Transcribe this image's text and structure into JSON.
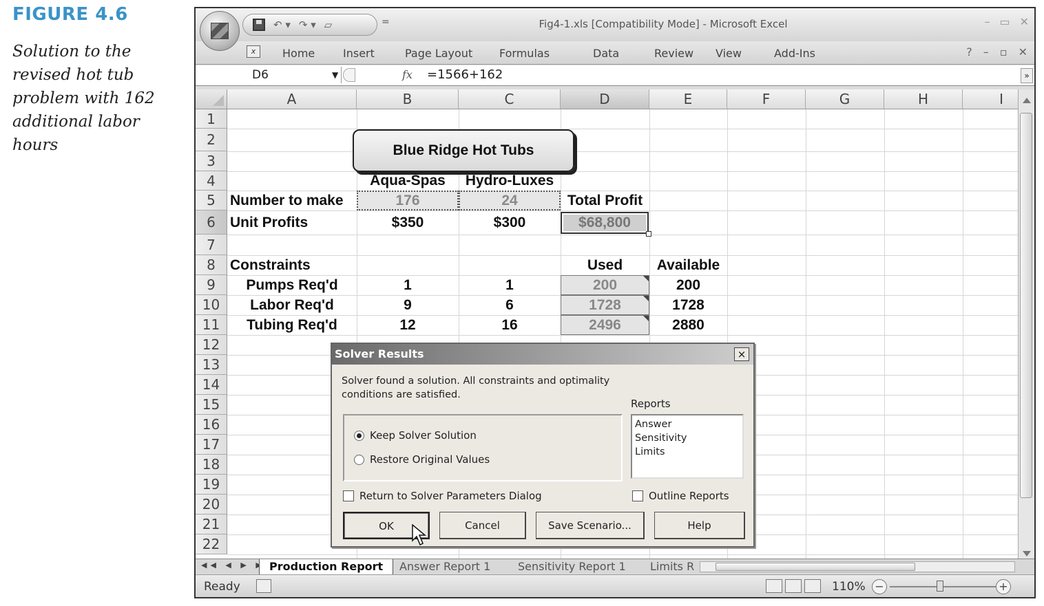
{
  "figure": {
    "label": "FIGURE 4.6",
    "caption_lines": [
      "Solution to the",
      "revised hot tub",
      "problem with 162",
      "additional labor",
      "hours"
    ]
  },
  "window": {
    "title": "Fig4-1.xls  [Compatibility Mode] - Microsoft Excel",
    "qat_more": "="
  },
  "ribbon": {
    "tabs": [
      "Home",
      "Insert",
      "Page Layout",
      "Formulas",
      "Data",
      "Review",
      "View",
      "Add-Ins"
    ]
  },
  "formula_bar": {
    "name_box": "D6",
    "fx": "fx",
    "formula": "=1566+162"
  },
  "columns": [
    "A",
    "B",
    "C",
    "D",
    "E",
    "F",
    "G",
    "H",
    "I"
  ],
  "rows": [
    "1",
    "2",
    "3",
    "4",
    "5",
    "6",
    "7",
    "8",
    "9",
    "10",
    "11",
    "12",
    "13",
    "14",
    "15",
    "16",
    "17",
    "18",
    "19",
    "20",
    "21",
    "22"
  ],
  "sheet": {
    "title": "Blue Ridge Hot Tubs",
    "headers": {
      "b4": "Aqua-Spas",
      "c4": "Hydro-Luxes"
    },
    "row5": {
      "label": "Number to make",
      "b": "176",
      "c": "24",
      "d": "Total Profit"
    },
    "row6": {
      "label": "Unit Profits",
      "b": "$350",
      "c": "$300",
      "d": "$68,800"
    },
    "row8": {
      "label": "Constraints",
      "d": "Used",
      "e": "Available"
    },
    "constraints": [
      {
        "label": "Pumps Req'd",
        "b": "1",
        "c": "1",
        "used": "200",
        "available": "200"
      },
      {
        "label": "Labor Req'd",
        "b": "9",
        "c": "6",
        "used": "1728",
        "available": "1728"
      },
      {
        "label": "Tubing Req'd",
        "b": "12",
        "c": "16",
        "used": "2496",
        "available": "2880"
      }
    ]
  },
  "solver_dialog": {
    "title": "Solver Results",
    "close": "×",
    "message_line1": "Solver found a solution.  All constraints and optimality",
    "message_line2": "conditions are satisfied.",
    "reports_label": "Reports",
    "reports": [
      "Answer",
      "Sensitivity",
      "Limits"
    ],
    "keep_label": "Keep Solver Solution",
    "restore_label": "Restore Original Values",
    "keep_selected": true,
    "return_label": "Return to Solver Parameters Dialog",
    "outline_label": "Outline Reports",
    "buttons": {
      "ok": "OK",
      "cancel": "Cancel",
      "save": "Save Scenario...",
      "help": "Help"
    }
  },
  "sheet_tabs": [
    "Production Report",
    "Answer Report 1",
    "Sensitivity Report 1",
    "Limits R"
  ],
  "status": {
    "text": "Ready",
    "zoom": "110%",
    "zoom_minus": "−",
    "zoom_plus": "+"
  }
}
